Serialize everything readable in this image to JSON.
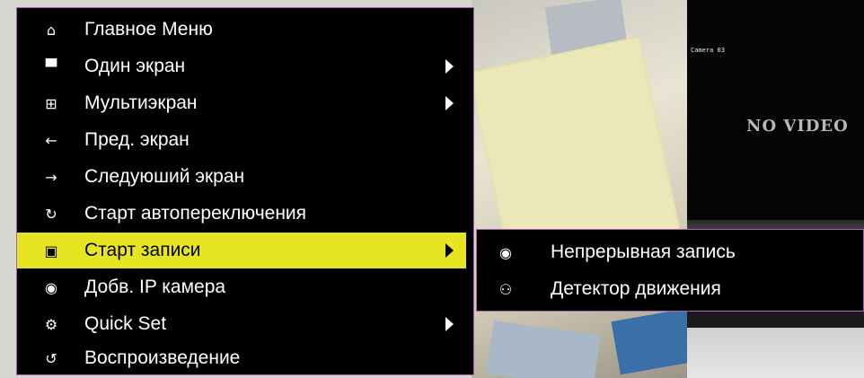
{
  "menu": {
    "items": [
      {
        "icon": "home-icon",
        "glyph": "⌂",
        "label": "Главное Меню",
        "has_submenu": false
      },
      {
        "icon": "single-screen-icon",
        "glyph": "▀",
        "label": "Один экран",
        "has_submenu": true
      },
      {
        "icon": "multiscreen-icon",
        "glyph": "⊞",
        "label": "Мультиэкран",
        "has_submenu": true
      },
      {
        "icon": "arrow-left-icon",
        "glyph": "←",
        "label": "Пред. экран",
        "has_submenu": false
      },
      {
        "icon": "arrow-right-icon",
        "glyph": "→",
        "label": "Следуюший экран",
        "has_submenu": false
      },
      {
        "icon": "auto-switch-icon",
        "glyph": "↻",
        "label": "Старт автопереключения",
        "has_submenu": false
      },
      {
        "icon": "record-icon",
        "glyph": "▣",
        "label": "Старт записи",
        "has_submenu": true,
        "active": true
      },
      {
        "icon": "add-ip-camera-icon",
        "glyph": "◉",
        "label": "Добв. IP камера",
        "has_submenu": false
      },
      {
        "icon": "gear-icon",
        "glyph": "⚙",
        "label": "Quick Set",
        "has_submenu": true
      },
      {
        "icon": "playback-icon",
        "glyph": "↺",
        "label": "Воспроизведение",
        "has_submenu": false
      }
    ],
    "active_color": "#e7e421",
    "border_color": "#a860b8"
  },
  "submenu": {
    "items": [
      {
        "icon": "continuous-record-icon",
        "glyph": "◉",
        "label": "Непрерывная запись"
      },
      {
        "icon": "motion-detect-icon",
        "glyph": "⚇",
        "label": "Детектор движения"
      }
    ]
  },
  "cameras": {
    "cam_label": "Camera 03",
    "no_video": "NO VIDEO"
  }
}
